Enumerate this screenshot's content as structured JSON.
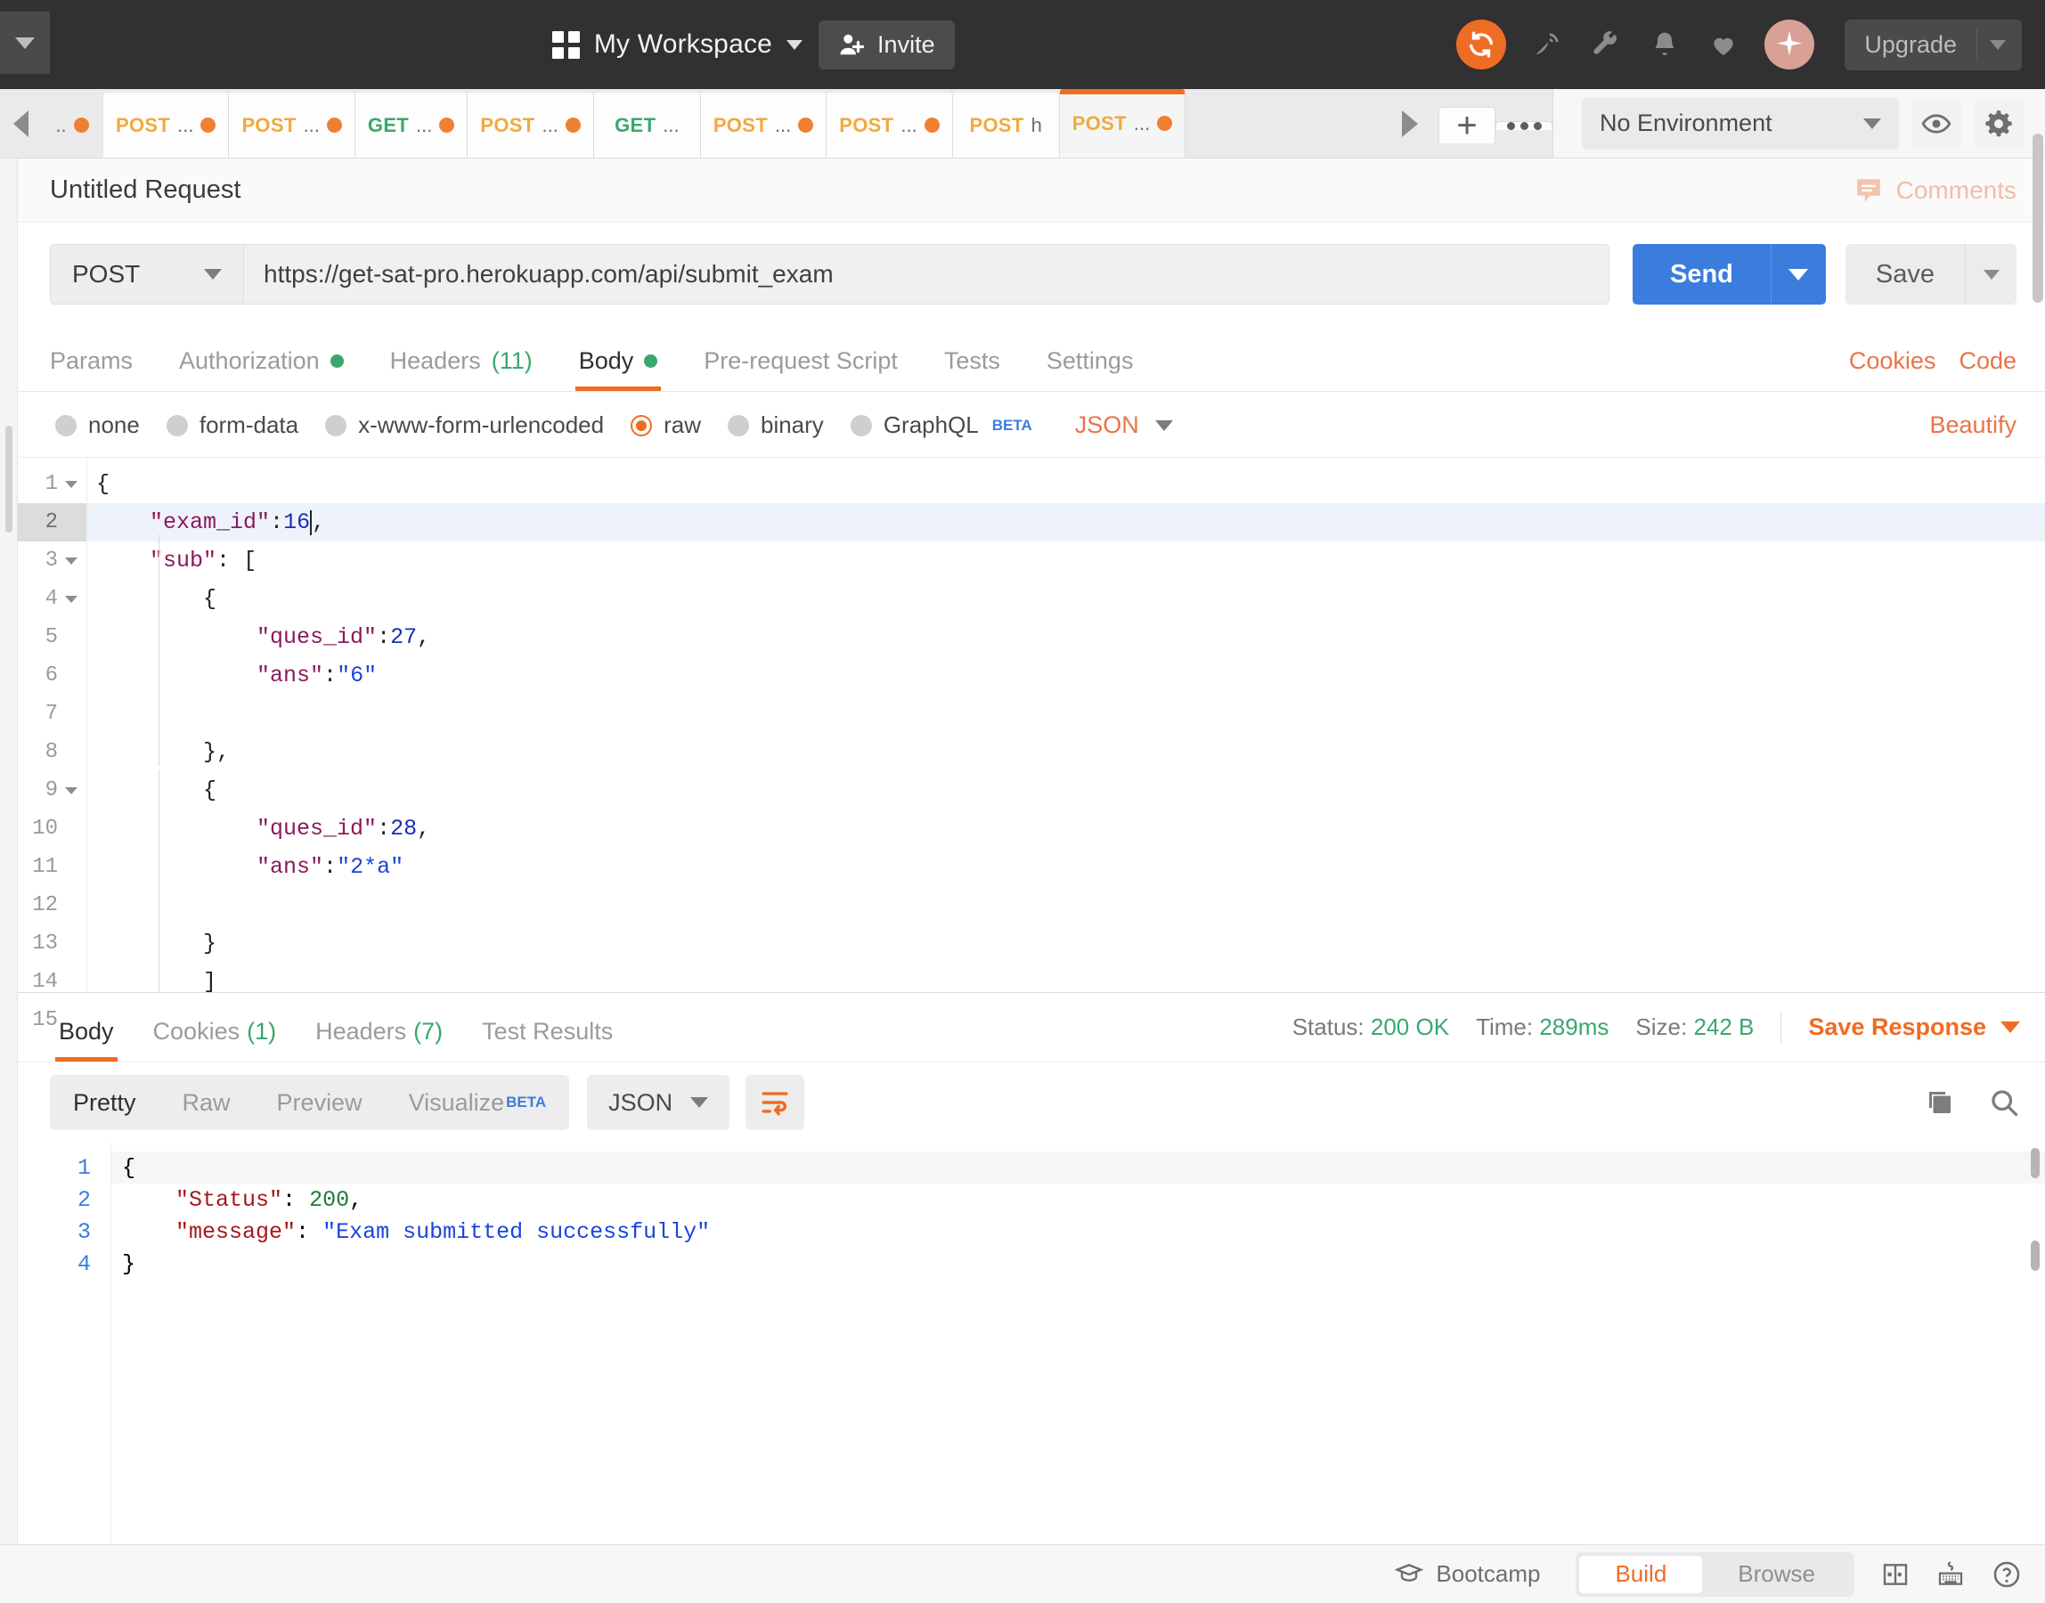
{
  "header": {
    "workspace_title": "My Workspace",
    "invite_label": "Invite",
    "upgrade_label": "Upgrade",
    "icons": [
      "sync-icon",
      "satellite-icon",
      "wrench-icon",
      "bell-icon",
      "heart-icon",
      "sparkle-icon"
    ]
  },
  "tabstrip": {
    "tabs": [
      {
        "method": "",
        "name": "..",
        "dirty": true,
        "active": false,
        "partial": true
      },
      {
        "method": "POST",
        "name": "...",
        "dirty": true,
        "active": false
      },
      {
        "method": "POST",
        "name": "...",
        "dirty": true,
        "active": false
      },
      {
        "method": "GET",
        "name": "...",
        "dirty": true,
        "active": false
      },
      {
        "method": "POST",
        "name": "...",
        "dirty": true,
        "active": false
      },
      {
        "method": "GET",
        "name": "...",
        "dirty": false,
        "active": false
      },
      {
        "method": "POST",
        "name": "...",
        "dirty": true,
        "active": false
      },
      {
        "method": "POST",
        "name": "...",
        "dirty": true,
        "active": false
      },
      {
        "method": "POST",
        "name": "h",
        "dirty": false,
        "active": false
      },
      {
        "method": "POST",
        "name": "...",
        "dirty": true,
        "active": true
      }
    ],
    "new_tab_label": "+",
    "environment": {
      "selected": "No Environment",
      "eye_icon": "eye-icon",
      "gear_icon": "gear-icon"
    }
  },
  "request": {
    "title": "Untitled Request",
    "comments_label": "Comments",
    "method": "POST",
    "url": "https://get-sat-pro.herokuapp.com/api/submit_exam",
    "send_label": "Send",
    "save_label": "Save",
    "tabs": [
      {
        "label": "Params",
        "badge": "",
        "dot": false,
        "active": false
      },
      {
        "label": "Authorization",
        "badge": "",
        "dot": true,
        "active": false
      },
      {
        "label": "Headers",
        "badge": "(11)",
        "dot": false,
        "active": false
      },
      {
        "label": "Body",
        "badge": "",
        "dot": true,
        "active": true
      },
      {
        "label": "Pre-request Script",
        "badge": "",
        "dot": false,
        "active": false
      },
      {
        "label": "Tests",
        "badge": "",
        "dot": false,
        "active": false
      },
      {
        "label": "Settings",
        "badge": "",
        "dot": false,
        "active": false
      }
    ],
    "cookies_link": "Cookies",
    "code_link": "Code",
    "body_types": [
      {
        "label": "none",
        "selected": false
      },
      {
        "label": "form-data",
        "selected": false
      },
      {
        "label": "x-www-form-urlencoded",
        "selected": false
      },
      {
        "label": "raw",
        "selected": true
      },
      {
        "label": "binary",
        "selected": false
      },
      {
        "label": "GraphQL",
        "selected": false,
        "beta": "BETA"
      }
    ],
    "raw_format": "JSON",
    "beautify_label": "Beautify",
    "body_lines": [
      {
        "num": "1",
        "fold": true,
        "current": false,
        "text": "{"
      },
      {
        "num": "2",
        "fold": false,
        "current": true,
        "text": "    \"exam_id\":16,"
      },
      {
        "num": "3",
        "fold": true,
        "current": false,
        "text": "    \"sub\": ["
      },
      {
        "num": "4",
        "fold": true,
        "current": false,
        "text": "        {"
      },
      {
        "num": "5",
        "fold": false,
        "current": false,
        "text": "            \"ques_id\":27,"
      },
      {
        "num": "6",
        "fold": false,
        "current": false,
        "text": "            \"ans\":\"6\""
      },
      {
        "num": "7",
        "fold": false,
        "current": false,
        "text": ""
      },
      {
        "num": "8",
        "fold": false,
        "current": false,
        "text": "        },"
      },
      {
        "num": "9",
        "fold": true,
        "current": false,
        "text": "        {"
      },
      {
        "num": "10",
        "fold": false,
        "current": false,
        "text": "            \"ques_id\":28,"
      },
      {
        "num": "11",
        "fold": false,
        "current": false,
        "text": "            \"ans\":\"2*a\""
      },
      {
        "num": "12",
        "fold": false,
        "current": false,
        "text": ""
      },
      {
        "num": "13",
        "fold": false,
        "current": false,
        "text": "        }"
      },
      {
        "num": "14",
        "fold": false,
        "current": false,
        "text": "        ]"
      },
      {
        "num": "15",
        "fold": false,
        "current": false,
        "text": "}"
      }
    ]
  },
  "response": {
    "tabs": [
      {
        "label": "Body",
        "badge": "",
        "active": true
      },
      {
        "label": "Cookies",
        "badge": "(1)",
        "active": false
      },
      {
        "label": "Headers",
        "badge": "(7)",
        "active": false
      },
      {
        "label": "Test Results",
        "badge": "",
        "active": false
      }
    ],
    "status_label": "Status:",
    "status_value": "200 OK",
    "time_label": "Time:",
    "time_value": "289ms",
    "size_label": "Size:",
    "size_value": "242 B",
    "save_response_label": "Save Response",
    "view_modes": [
      {
        "label": "Pretty",
        "active": true
      },
      {
        "label": "Raw",
        "active": false
      },
      {
        "label": "Preview",
        "active": false
      },
      {
        "label": "Visualize",
        "active": false,
        "beta": "BETA"
      }
    ],
    "format": "JSON",
    "body_lines": [
      {
        "num": "1",
        "text": "{"
      },
      {
        "num": "2",
        "text": "    \"Status\": 200,"
      },
      {
        "num": "3",
        "text": "    \"message\": \"Exam submitted successfully\""
      },
      {
        "num": "4",
        "text": "}"
      }
    ]
  },
  "bottombar": {
    "bootcamp_label": "Bootcamp",
    "build_label": "Build",
    "browse_label": "Browse",
    "icons": [
      "two-pane-icon",
      "keyboard-icon",
      "help-icon"
    ]
  }
}
